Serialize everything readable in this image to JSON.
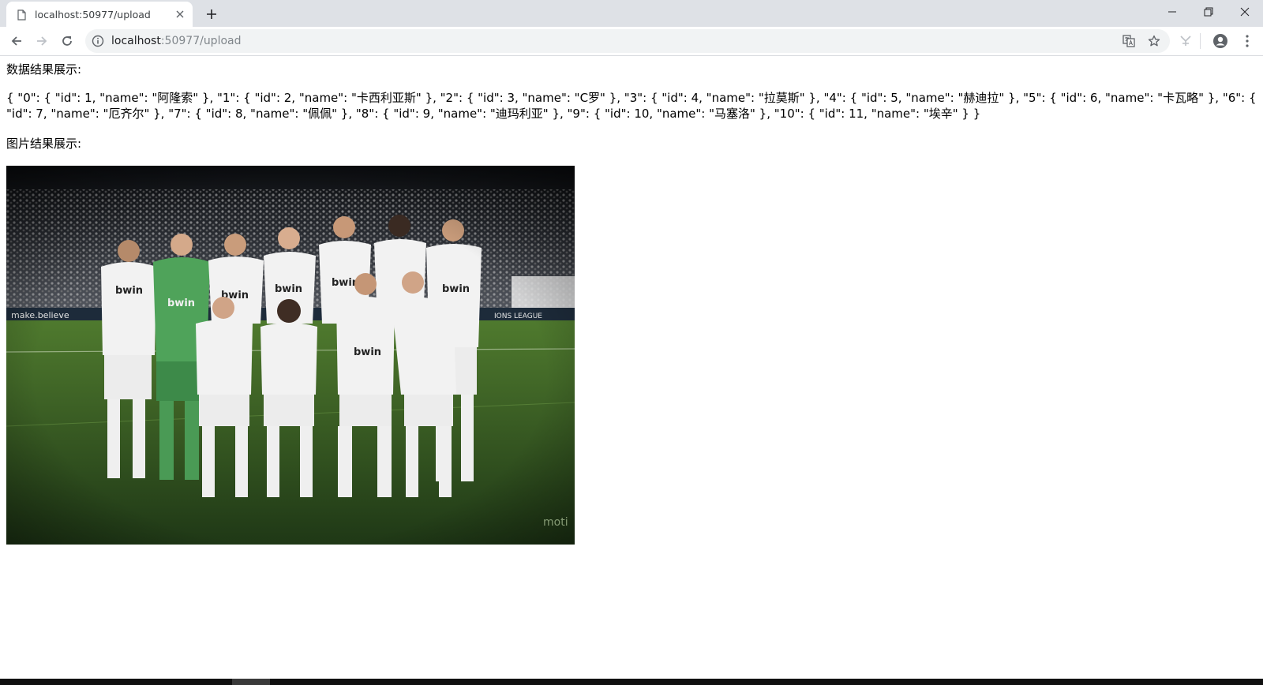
{
  "browser": {
    "tab": {
      "title": "localhost:50977/upload",
      "icon": "page-icon"
    },
    "new_tab_icon": "plus-icon",
    "window_controls": [
      "minimize-icon",
      "restore-icon",
      "close-icon"
    ],
    "url": {
      "host": "localhost",
      "rest": ":50977/upload"
    },
    "toolbar_icons": [
      "back-arrow-icon",
      "forward-arrow-icon",
      "reload-icon",
      "info-icon",
      "translate-icon",
      "star-icon",
      "extension-icon",
      "profile-icon",
      "menu-icon"
    ]
  },
  "page": {
    "data_label": "数据结果展示:",
    "json_result": "{ \"0\": { \"id\": 1, \"name\": \"阿隆索\" }, \"1\": { \"id\": 2, \"name\": \"卡西利亚斯\" }, \"2\": { \"id\": 3, \"name\": \"C罗\" }, \"3\": { \"id\": 4, \"name\": \"拉莫斯\" }, \"4\": { \"id\": 5, \"name\": \"赫迪拉\" }, \"5\": { \"id\": 6, \"name\": \"卡瓦略\" }, \"6\": { \"id\": 7, \"name\": \"厄齐尔\" }, \"7\": { \"id\": 8, \"name\": \"佩佩\" }, \"8\": { \"id\": 9, \"name\": \"迪玛利亚\" }, \"9\": { \"id\": 10, \"name\": \"马塞洛\" }, \"10\": { \"id\": 11, \"name\": \"埃辛\" } }",
    "image_label": "图片结果展示:",
    "photo": {
      "description": "team-photo",
      "jersey_sponsor": "bwin",
      "banner_left": "make believe",
      "banner_right": "UEFA CHAMPIONS LEAGUE",
      "watermark": "moti",
      "colors": {
        "sky": "#0b0d10",
        "crowd": "#3a3d44",
        "grass_light": "#4f7a2e",
        "grass_dark": "#24401a",
        "kit": "#f2f2f2",
        "keeper_kit": "#4fa35a"
      }
    }
  }
}
